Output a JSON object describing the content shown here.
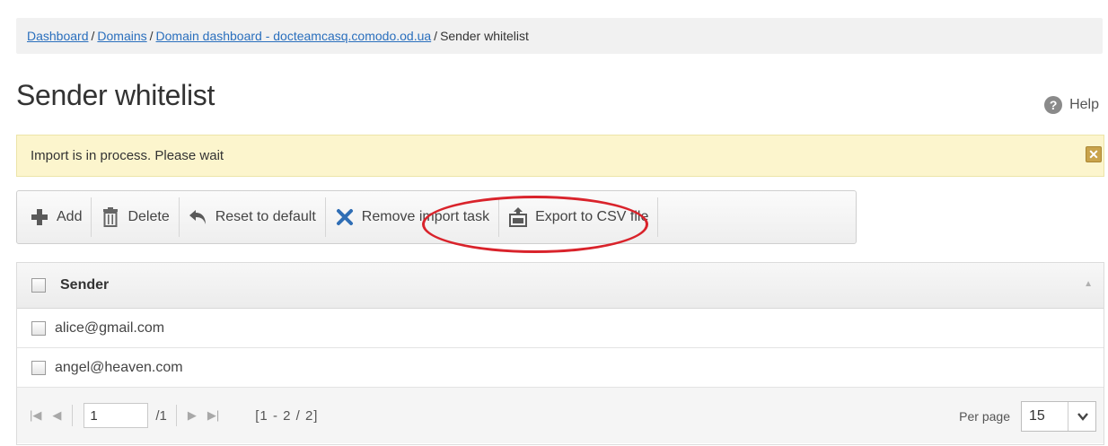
{
  "breadcrumb": {
    "items": [
      "Dashboard",
      "Domains",
      "Domain dashboard - docteamcasq.comodo.od.ua"
    ],
    "current": "Sender whitelist",
    "separator": "/"
  },
  "page": {
    "title": "Sender whitelist",
    "help_label": "Help",
    "help_icon": "?"
  },
  "notice": {
    "message": "Import is in process. Please wait",
    "close_icon": "✕"
  },
  "toolbar": {
    "add_label": "Add",
    "delete_label": "Delete",
    "reset_label": "Reset to default",
    "remove_import_label": "Remove import task",
    "export_label": "Export to CSV file"
  },
  "table": {
    "column_header": "Sender",
    "sort_icon": "▲",
    "rows": [
      {
        "sender": "alice@gmail.com"
      },
      {
        "sender": "angel@heaven.com"
      }
    ]
  },
  "pager": {
    "first_icon": "|◀",
    "prev_icon": "◀",
    "current_page": "1",
    "total_pages": "/1",
    "next_icon": "▶",
    "last_icon": "▶|",
    "range": "[1 - 2 / 2]",
    "per_page_label": "Per page",
    "per_page_value": "15",
    "chevron_icon": "❯"
  },
  "colors": {
    "link": "#2a6fbd",
    "notice_bg": "#fcf5cd",
    "highlight": "#d9232b",
    "add_icon": "#5a5a5a",
    "remove_icon": "#2f6eb5"
  }
}
